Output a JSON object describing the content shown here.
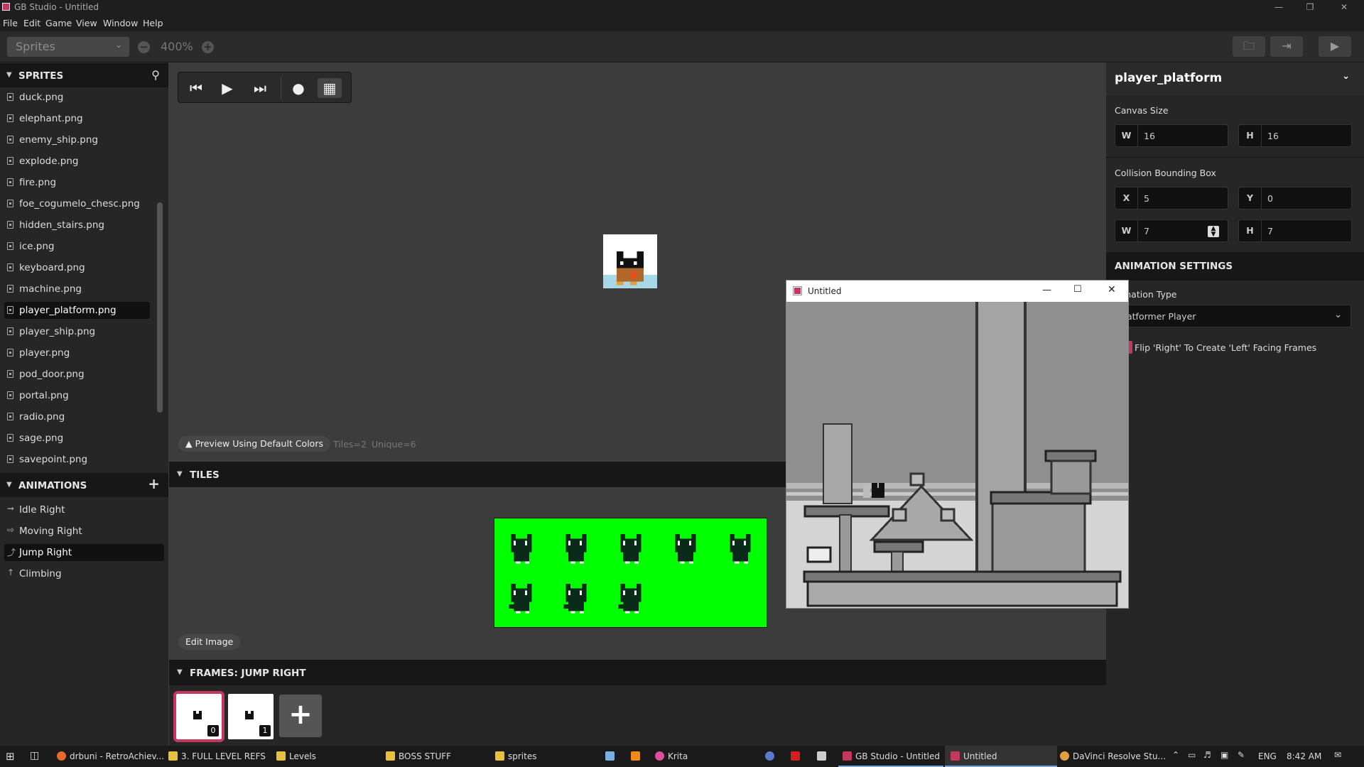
{
  "window": {
    "title": "GB Studio - Untitled"
  },
  "menu": [
    "File",
    "Edit",
    "Game",
    "View",
    "Window",
    "Help"
  ],
  "toolbar": {
    "section": "Sprites",
    "zoom": "400%"
  },
  "sidebar": {
    "sprites_header": "SPRITES",
    "files": [
      "duck.png",
      "elephant.png",
      "enemy_ship.png",
      "explode.png",
      "fire.png",
      "foe_cogumelo_chesc.png",
      "hidden_stairs.png",
      "ice.png",
      "keyboard.png",
      "machine.png",
      "player_platform.png",
      "player_ship.png",
      "player.png",
      "pod_door.png",
      "portal.png",
      "radio.png",
      "sage.png",
      "savepoint.png"
    ],
    "selected_file": "player_platform.png",
    "animations_header": "ANIMATIONS",
    "animations": [
      "Idle Right",
      "Moving Right",
      "Jump Right",
      "Climbing"
    ],
    "selected_animation": "Jump Right"
  },
  "editor": {
    "preview_button": "▲ Preview Using Default Colors",
    "tiles_stat": "Tiles=2",
    "unique_stat": "Unique=6",
    "tiles_header": "TILES",
    "edit_image": "Edit Image",
    "frames_header": "FRAMES: JUMP RIGHT",
    "frames": [
      "0",
      "1"
    ],
    "tile_bg_color": "#00ff00"
  },
  "inspector": {
    "name": "player_platform",
    "canvas_size_label": "Canvas Size",
    "canvas": {
      "w_key": "W",
      "w": "16",
      "h_key": "H",
      "h": "16"
    },
    "collision_label": "Collision Bounding Box",
    "collision": {
      "x_key": "X",
      "x": "5",
      "y_key": "Y",
      "y": "0",
      "w_key": "W",
      "w": "7",
      "h_key": "H",
      "h": "7"
    },
    "animation_settings": "ANIMATION SETTINGS",
    "animation_type_label": "mation Type",
    "animation_type_value": "atformer Player",
    "flip_label": "Flip 'Right' To Create 'Left' Facing Frames",
    "accent": "#c4385e"
  },
  "game_window": {
    "title": "Untitled"
  },
  "taskbar": {
    "apps": [
      "drbuni - RetroAchiev...",
      "3. FULL LEVEL REFS",
      "Levels",
      "BOSS STUFF",
      "sprites",
      "Krita",
      "GB Studio - Untitled",
      "Untitled",
      "DaVinci Resolve Stu..."
    ],
    "lang": "ENG",
    "time": "8:42 AM"
  }
}
